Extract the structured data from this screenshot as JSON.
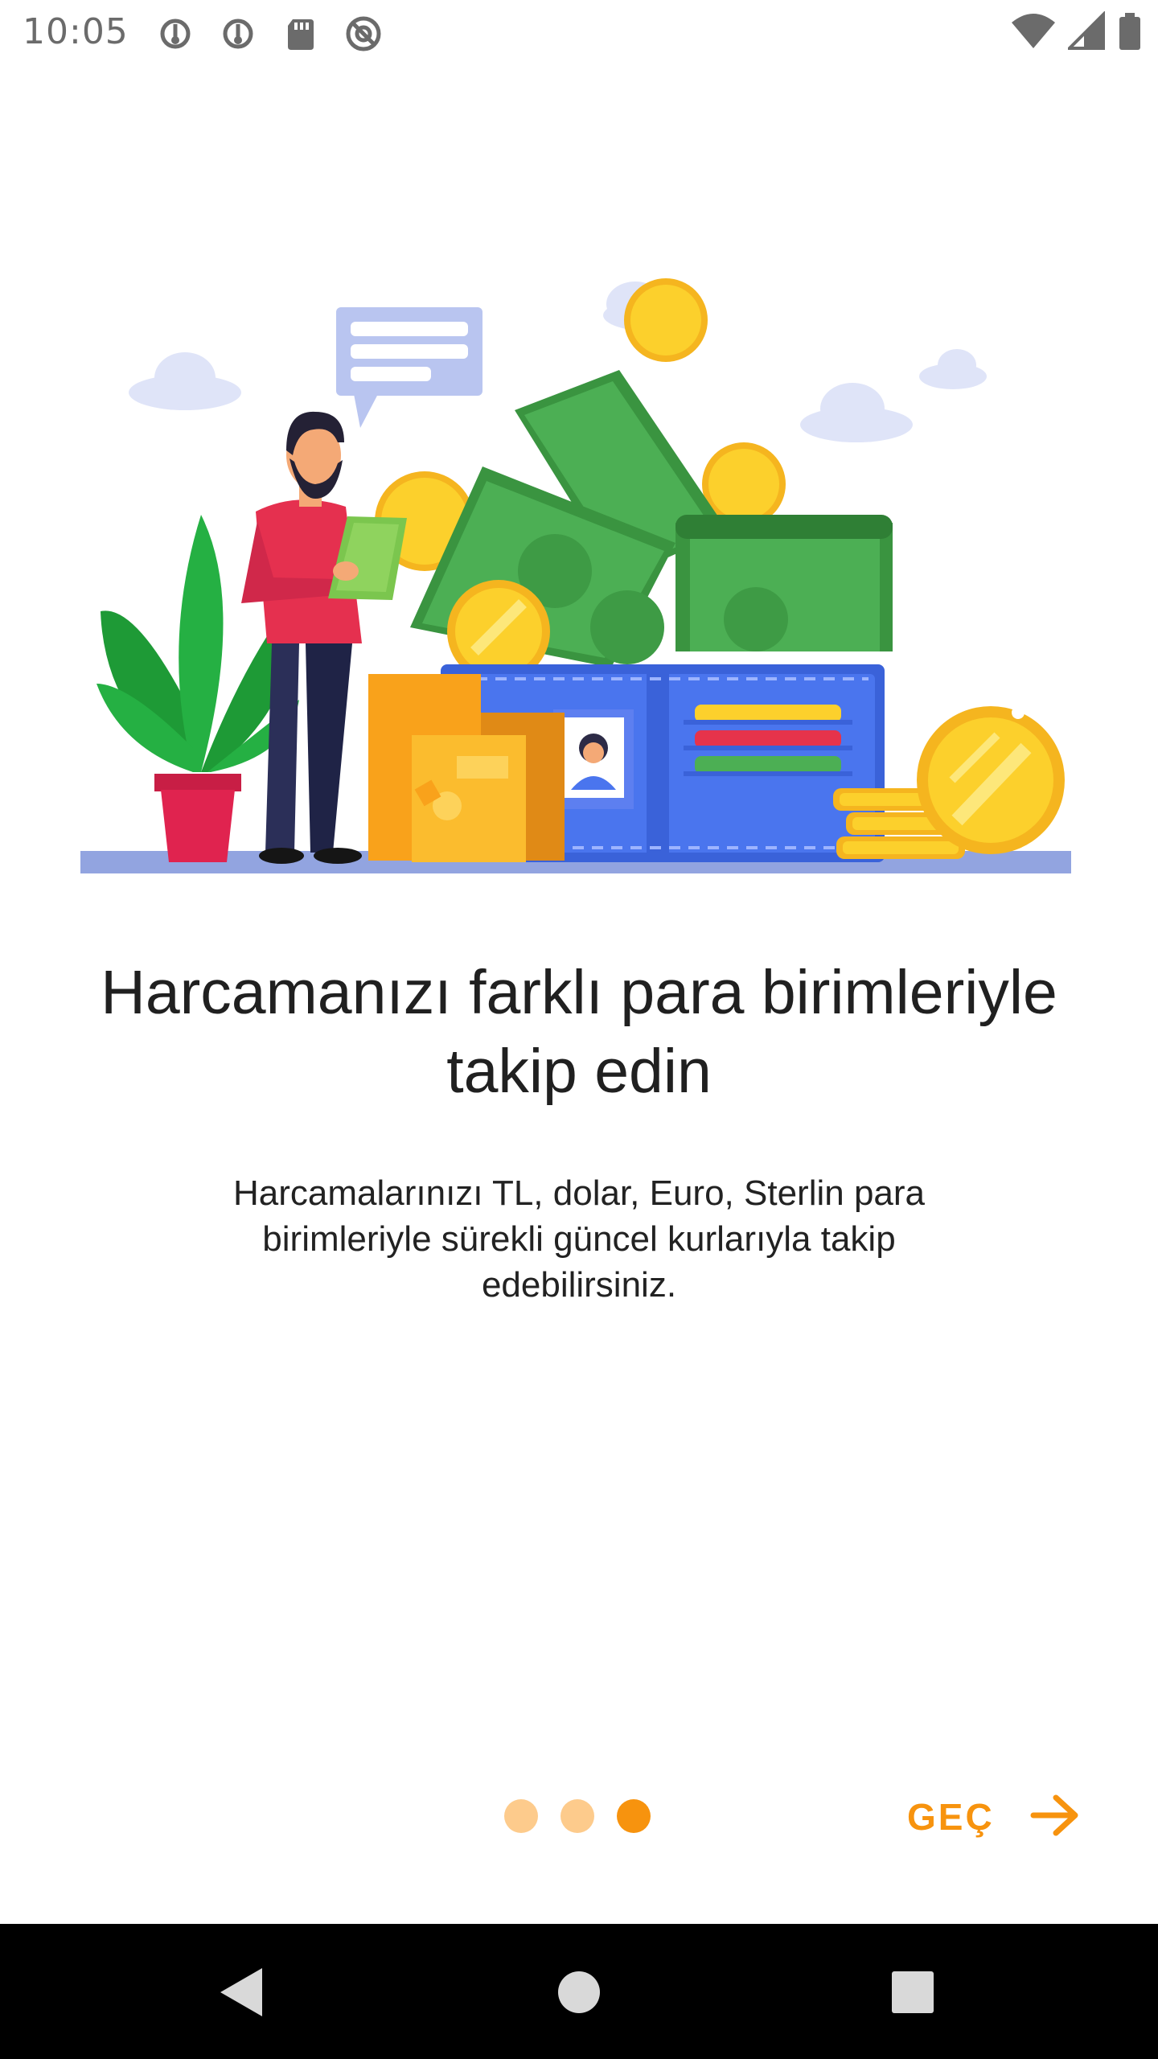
{
  "status_bar": {
    "time": "10:05",
    "left_icons": [
      "lock-sync-icon",
      "lock-sync-icon",
      "sd-card-icon",
      "no-tracking-icon"
    ],
    "right_icons": [
      "wifi-icon",
      "cellular-signal-icon",
      "battery-icon"
    ]
  },
  "onboarding": {
    "illustration": "money-wallet-illustration",
    "title": "Harcamanızı farklı para birimleriyle takip edin",
    "description": "Harcamalarınızı TL, dolar, Euro, Sterlin para birimleriyle sürekli güncel kurlarıyla takip edebilirsiniz.",
    "page_indicator": {
      "total": 3,
      "current": 3,
      "active_color": "#f7930e",
      "inactive_color": "#fdcb8c"
    },
    "skip_label": "GEÇ",
    "accent_color": "#f7930e"
  },
  "nav_bar": {
    "buttons": [
      "back-icon",
      "home-icon",
      "recents-icon"
    ]
  }
}
